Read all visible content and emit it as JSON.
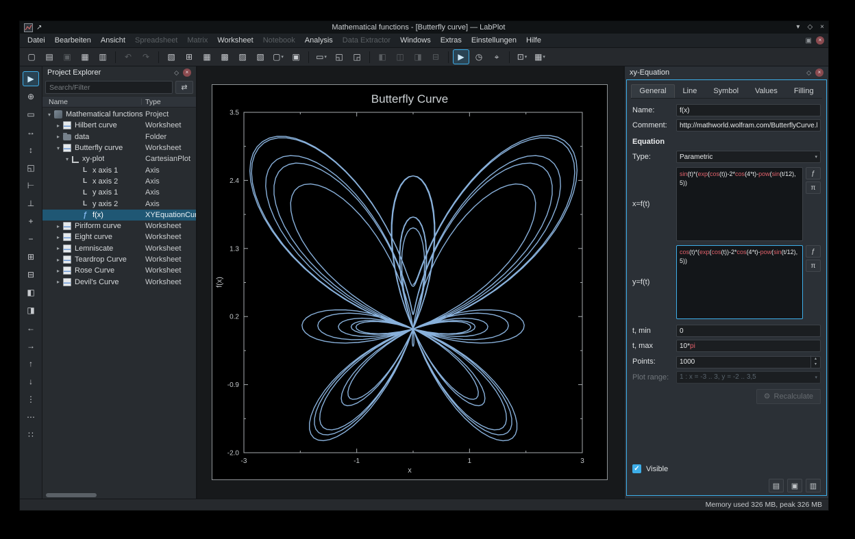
{
  "window": {
    "title": "Mathematical functions - [Butterfly curve] — LabPlot"
  },
  "icons": {
    "chevron_down": "▾",
    "chevron_up": "▴",
    "diamond": "◇",
    "close": "×",
    "pin": "↗",
    "menu_grid": "▣",
    "expanded": "▾",
    "collapsed": "▸",
    "filter": "⇄",
    "gear": "⚙",
    "check": "✓",
    "functions": "ƒ",
    "constants": "π",
    "axis_glyph": "L",
    "curve_glyph": "ƒ",
    "doc_load": "▤",
    "doc_save": "▣",
    "doc_options": "▥"
  },
  "menu": {
    "items": [
      {
        "label": "Datei",
        "enabled": true
      },
      {
        "label": "Bearbeiten",
        "enabled": true
      },
      {
        "label": "Ansicht",
        "enabled": true
      },
      {
        "label": "Spreadsheet",
        "enabled": false
      },
      {
        "label": "Matrix",
        "enabled": false
      },
      {
        "label": "Worksheet",
        "enabled": true
      },
      {
        "label": "Notebook",
        "enabled": false
      },
      {
        "label": "Analysis",
        "enabled": true
      },
      {
        "label": "Data Extractor",
        "enabled": false
      },
      {
        "label": "Windows",
        "enabled": true
      },
      {
        "label": "Extras",
        "enabled": true
      },
      {
        "label": "Einstellungen",
        "enabled": true
      },
      {
        "label": "Hilfe",
        "enabled": true
      }
    ]
  },
  "toolbar": {
    "buttons": [
      {
        "name": "new-project",
        "glyph": "▢"
      },
      {
        "name": "open-project",
        "glyph": "▤"
      },
      {
        "name": "save-project",
        "glyph": "▣",
        "disabled": true
      },
      {
        "name": "print",
        "glyph": "▦"
      },
      {
        "name": "print-preview",
        "glyph": "▥"
      },
      {
        "sep": true
      },
      {
        "name": "undo",
        "glyph": "↶",
        "disabled": true
      },
      {
        "name": "redo",
        "glyph": "↷",
        "disabled": true
      },
      {
        "sep": true
      },
      {
        "name": "new-folder",
        "glyph": "▧"
      },
      {
        "name": "new-workbook",
        "glyph": "⊞"
      },
      {
        "name": "new-spreadsheet",
        "glyph": "▦"
      },
      {
        "name": "new-matrix",
        "glyph": "▩"
      },
      {
        "name": "new-worksheet",
        "glyph": "▨"
      },
      {
        "name": "new-notebook",
        "glyph": "▧"
      },
      {
        "name": "new-plot",
        "glyph": "▢",
        "dropdown": true
      },
      {
        "name": "import-data",
        "glyph": "▣"
      },
      {
        "sep": true
      },
      {
        "name": "zoom-mode",
        "glyph": "▭",
        "dropdown": true
      },
      {
        "name": "fit-to-page",
        "glyph": "◱"
      },
      {
        "name": "fit-to-width",
        "glyph": "◲"
      },
      {
        "sep": true
      },
      {
        "name": "align-left",
        "glyph": "◧",
        "disabled": true
      },
      {
        "name": "align-center",
        "glyph": "◫",
        "disabled": true
      },
      {
        "name": "align-right",
        "glyph": "◨",
        "disabled": true
      },
      {
        "name": "snap-to-grid",
        "glyph": "⊟",
        "disabled": true
      },
      {
        "sep": true
      },
      {
        "name": "presenter-mode",
        "glyph": "▶",
        "active": true
      },
      {
        "name": "refresh-interval",
        "glyph": "◷"
      },
      {
        "name": "select-region",
        "glyph": "⌖"
      },
      {
        "sep": true
      },
      {
        "name": "cartesian-plot-actions",
        "glyph": "⊡",
        "dropdown": true
      },
      {
        "name": "add-new",
        "glyph": "▦",
        "dropdown": true
      }
    ]
  },
  "left_toolbar": {
    "buttons": [
      {
        "name": "select-mode",
        "glyph": "▶",
        "active": true
      },
      {
        "name": "crosshair-mode",
        "glyph": "⊕"
      },
      {
        "name": "zoom-select-mode",
        "glyph": "▭"
      },
      {
        "name": "zoom-x-select-mode",
        "glyph": "↔"
      },
      {
        "name": "zoom-y-select-mode",
        "glyph": "↕"
      },
      {
        "name": "auto-scale",
        "glyph": "◱"
      },
      {
        "name": "auto-scale-x",
        "glyph": "⊢"
      },
      {
        "name": "auto-scale-y",
        "glyph": "⊥"
      },
      {
        "name": "zoom-in",
        "glyph": "+"
      },
      {
        "name": "zoom-out",
        "glyph": "−"
      },
      {
        "name": "zoom-in-x",
        "glyph": "⊞"
      },
      {
        "name": "zoom-out-x",
        "glyph": "⊟"
      },
      {
        "name": "zoom-in-y",
        "glyph": "◧"
      },
      {
        "name": "zoom-out-y",
        "glyph": "◨"
      },
      {
        "name": "shift-left-x",
        "glyph": "←"
      },
      {
        "name": "shift-right-x",
        "glyph": "→"
      },
      {
        "name": "shift-up-y",
        "glyph": "↑"
      },
      {
        "name": "shift-down-y",
        "glyph": "↓"
      },
      {
        "name": "cursor-mode",
        "glyph": "⋮"
      },
      {
        "name": "data-picker-mode",
        "glyph": "⋯"
      },
      {
        "name": "more-tools",
        "glyph": "∷"
      }
    ]
  },
  "project_explorer": {
    "title": "Project Explorer",
    "search_placeholder": "Search/Filter",
    "columns": [
      "Name",
      "Type"
    ],
    "rows": [
      {
        "name": "Mathematical functions",
        "type": "Project",
        "depth": 0,
        "icon": "project",
        "expand": "open"
      },
      {
        "name": "Hilbert curve",
        "type": "Worksheet",
        "depth": 1,
        "icon": "worksheet",
        "expand": "closed"
      },
      {
        "name": "data",
        "type": "Folder",
        "depth": 1,
        "icon": "folder",
        "expand": "closed"
      },
      {
        "name": "Butterfly curve",
        "type": "Worksheet",
        "depth": 1,
        "icon": "worksheet",
        "expand": "open"
      },
      {
        "name": "xy-plot",
        "type": "CartesianPlot",
        "depth": 2,
        "icon": "plot",
        "expand": "open"
      },
      {
        "name": "x axis 1",
        "type": "Axis",
        "depth": 3,
        "icon": "axis"
      },
      {
        "name": "x axis 2",
        "type": "Axis",
        "depth": 3,
        "icon": "axis"
      },
      {
        "name": "y axis 1",
        "type": "Axis",
        "depth": 3,
        "icon": "axis"
      },
      {
        "name": "y axis 2",
        "type": "Axis",
        "depth": 3,
        "icon": "axis"
      },
      {
        "name": "f(x)",
        "type": "XYEquationCurve",
        "depth": 3,
        "icon": "curve",
        "selected": true
      },
      {
        "name": "Piriform curve",
        "type": "Worksheet",
        "depth": 1,
        "icon": "worksheet",
        "expand": "closed"
      },
      {
        "name": "Eight curve",
        "type": "Worksheet",
        "depth": 1,
        "icon": "worksheet",
        "expand": "closed"
      },
      {
        "name": "Lemniscate",
        "type": "Worksheet",
        "depth": 1,
        "icon": "worksheet",
        "expand": "closed"
      },
      {
        "name": "Teardrop Curve",
        "type": "Worksheet",
        "depth": 1,
        "icon": "worksheet",
        "expand": "closed"
      },
      {
        "name": "Rose Curve",
        "type": "Worksheet",
        "depth": 1,
        "icon": "worksheet",
        "expand": "closed"
      },
      {
        "name": "Devil's Curve",
        "type": "Worksheet",
        "depth": 1,
        "icon": "worksheet",
        "expand": "closed"
      }
    ]
  },
  "properties": {
    "title": "xy-Equation",
    "tabs": [
      "General",
      "Line",
      "Symbol",
      "Values",
      "Filling"
    ],
    "active_tab": "General",
    "name_label": "Name:",
    "name_value": "f(x)",
    "comment_label": "Comment:",
    "comment_value": "http://mathworld.wolfram.com/ButterflyCurve.html",
    "equation_heading": "Equation",
    "type_label": "Type:",
    "type_value": "Parametric",
    "x_label": "x=f(t)",
    "x_value": "sin(t)*(exp(cos(t))-2*cos(4*t)-pow(sin(t/12), 5))",
    "y_label": "y=f(t)",
    "y_value": "cos(t)*(exp(cos(t))-2*cos(4*t)-pow(sin(t/12),5))",
    "tmin_label": "t, min",
    "tmin_value": "0",
    "tmax_label": "t, max",
    "tmax_value": "10*pi",
    "points_label": "Points:",
    "points_value": "1000",
    "plot_range_label": "Plot range:",
    "plot_range_value": "1 : x = -3 .. 3, y = -2 .. 3,5",
    "recalculate_label": "Recalculate",
    "visible_label": "Visible"
  },
  "statusbar": {
    "memory_text": "Memory used 326 MB, peak 326 MB"
  },
  "chart_data": {
    "type": "line",
    "title": "Butterfly Curve",
    "xlabel": "x",
    "ylabel": "f(x)",
    "parametric": true,
    "x_equation": "sin(t)*(exp(cos(t))-2*cos(4*t)-pow(sin(t/12), 5))",
    "y_equation": "cos(t)*(exp(cos(t))-2*cos(4*t)-pow(sin(t/12),5))",
    "t_min": "0",
    "t_max": "10*pi",
    "points": 1000,
    "xlim": [
      -3,
      3
    ],
    "ylim": [
      -2,
      3.5
    ],
    "x_ticks": [
      "-3",
      "-1",
      "1",
      "3"
    ],
    "y_ticks": [
      "3.5",
      "2.4",
      "1.3",
      "0.2",
      "-0.9",
      "-2.0"
    ],
    "grid": false,
    "legend": false,
    "background": "#000000",
    "curve_color": "#8fb9e6",
    "axis_color": "#a8adb0"
  }
}
